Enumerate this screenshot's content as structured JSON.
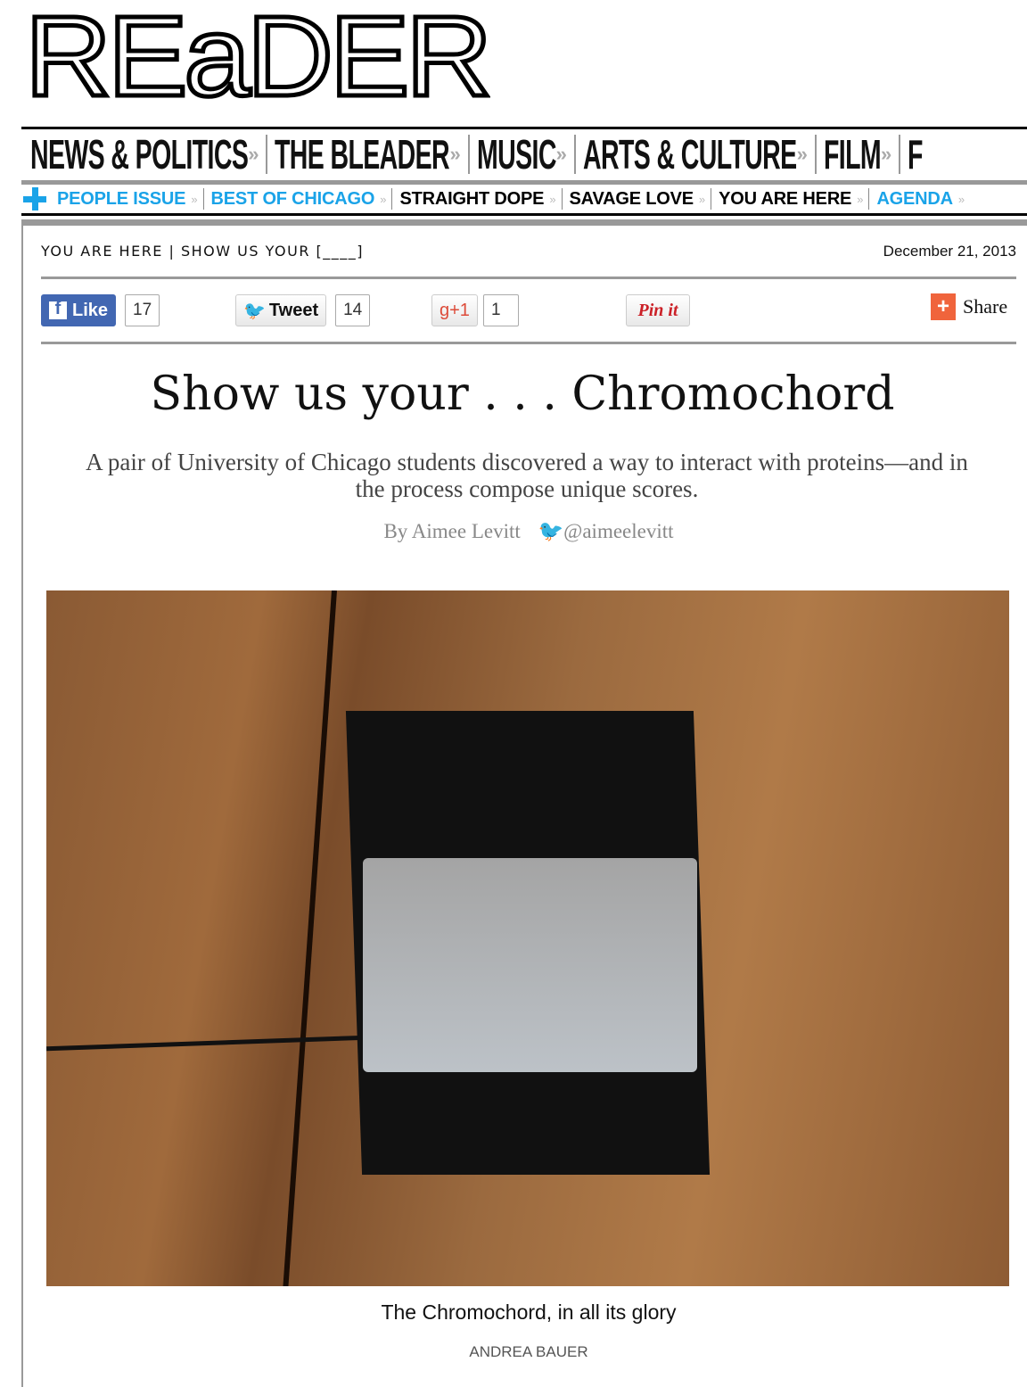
{
  "logo": "REaDER",
  "main_nav": [
    "NEWS & POLITICS",
    "THE BLEADER",
    "MUSIC",
    "ARTS & CULTURE",
    "FILM",
    "F"
  ],
  "sub_nav": [
    {
      "label": "PEOPLE ISSUE",
      "color": "#1aa3e8"
    },
    {
      "label": "BEST OF CHICAGO",
      "color": "#1aa3e8"
    },
    {
      "label": "STRAIGHT DOPE",
      "color": "#000000"
    },
    {
      "label": "SAVAGE LOVE",
      "color": "#000000"
    },
    {
      "label": "YOU ARE HERE",
      "color": "#000000"
    },
    {
      "label": "AGENDA",
      "color": "#1aa3e8"
    }
  ],
  "raquo": "»",
  "breadcrumb": "YOU ARE HERE | SHOW US YOUR [____]",
  "date": "December 21, 2013",
  "social": {
    "like_label": "Like",
    "like_count": "17",
    "tweet_label": "Tweet",
    "tweet_count": "14",
    "gplus_label": "g+1",
    "gplus_count": "1",
    "pin_label": "Pin it",
    "share_label": "Share"
  },
  "article": {
    "title": "Show us your . . . Chromochord",
    "deck": "A pair of University of Chicago students discovered a way to interact with proteins—and in the process compose unique scores.",
    "byline": "By Aimee Levitt",
    "twitter": "@aimeelevitt",
    "caption": "The Chromochord, in all its glory",
    "credit": "ANDREA BAUER"
  }
}
